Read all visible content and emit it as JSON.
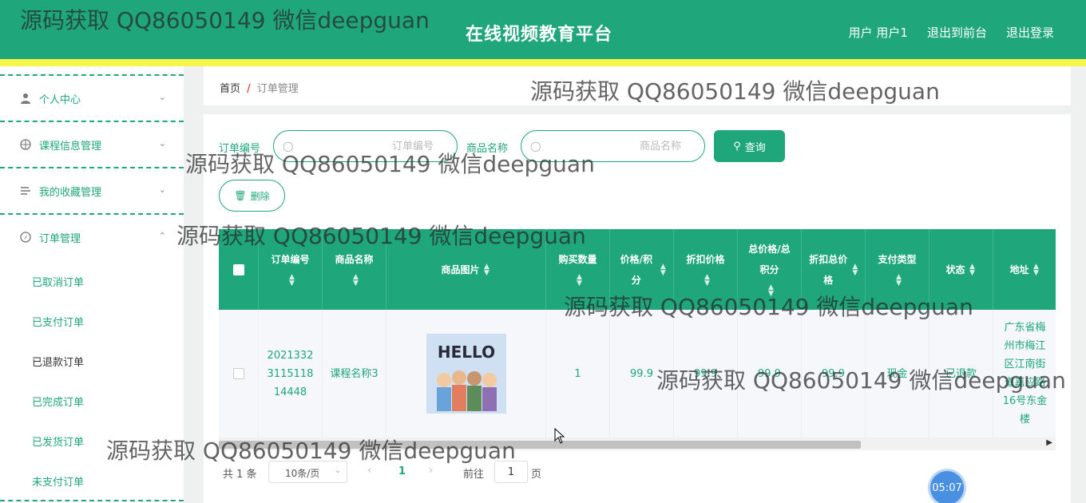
{
  "header": {
    "title": "在线视频教育平台",
    "user_label": "用户 用户1",
    "back_to_front": "退出到前台",
    "logout": "退出登录"
  },
  "sidebar": {
    "items": [
      {
        "label": "个人中心",
        "icon": "user-icon"
      },
      {
        "label": "课程信息管理",
        "icon": "course-icon"
      },
      {
        "label": "我的收藏管理",
        "icon": "favorites-icon"
      },
      {
        "label": "订单管理",
        "icon": "compass-icon"
      }
    ],
    "subitems": [
      "已取消订单",
      "已支付订单",
      "已退款订单",
      "已完成订单",
      "已发货订单",
      "未支付订单"
    ]
  },
  "breadcrumb": {
    "home": "首页",
    "separator": "/",
    "current": "订单管理"
  },
  "search": {
    "order_no_label": "订单编号",
    "order_no_placeholder": "订单编号",
    "product_label": "商品名称",
    "product_placeholder": "商品名称",
    "query_label": "查询",
    "delete_label": "删除"
  },
  "table": {
    "columns": [
      "订单编号",
      "商品名称",
      "商品图片",
      "购买数量",
      "价格/积分",
      "折扣价格",
      "总价格/总积分",
      "折扣总价格",
      "支付类型",
      "状态",
      "地址"
    ],
    "rows": [
      {
        "order_no": "20213323115118 14448",
        "product": "课程名称3",
        "image_label": "HELLO",
        "quantity": "1",
        "price": "99.9",
        "discount_price": "99.9",
        "total": "99.9",
        "discount_total": "99.9",
        "pay_type": "现金",
        "status": "已退款",
        "address": "广东省梅州市梅江区江南街道嘉应路16号东金楼"
      }
    ]
  },
  "pagination": {
    "total": "共 1 条",
    "page_size": "10条/页",
    "current_page": "1",
    "goto_label": "前往",
    "goto_value": "1",
    "page_unit": "页"
  },
  "watermark": "源码获取 QQ86050149 微信deepguan",
  "clock": "05:07",
  "colors": {
    "primary": "#1fa67a",
    "header_stripe": "#f5f54a"
  }
}
